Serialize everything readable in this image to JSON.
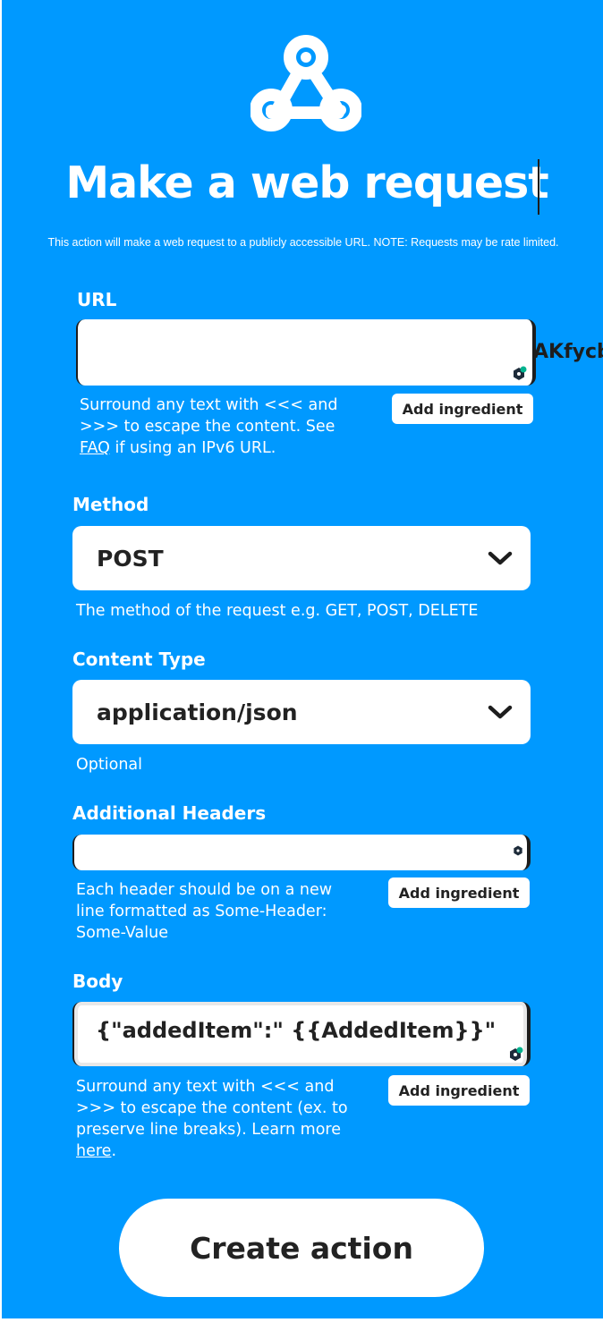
{
  "header": {
    "logo_icon": "webhooks-icon",
    "title": "Make a web request",
    "description": "This action will make a web request to a publicly accessible URL. NOTE: Requests may be rate limited."
  },
  "url": {
    "label": "URL",
    "value": "",
    "overflow_text": "AKfycb",
    "help_before": "Surround any text with <<< and >>> to escape the content. See ",
    "help_link": "FAQ",
    "help_after": " if using an IPv6 URL.",
    "ingredient_label": "Add ingredient"
  },
  "method": {
    "label": "Method",
    "selected": "POST",
    "help": "The method of the request e.g. GET, POST, DELETE"
  },
  "content_type": {
    "label": "Content Type",
    "selected": "application/json",
    "help": "Optional"
  },
  "headers": {
    "label": "Additional Headers",
    "value": "",
    "help": "Each header should be on a new line formatted as Some-Header: Some-Value",
    "ingredient_label": "Add ingredient"
  },
  "body": {
    "label": "Body",
    "value": "{\"addedItem\":\" {{AddedItem}}\"",
    "help_before": "Surround any text with <<< and >>> to escape the content (ex. to preserve line breaks). Learn more ",
    "help_link": "here",
    "help_after": ".",
    "ingredient_label": "Add ingredient"
  },
  "actions": {
    "create_label": "Create action"
  },
  "colors": {
    "background": "#0099ff",
    "foreground": "#ffffff",
    "text_dark": "#222222",
    "badge": "#00b38f"
  }
}
